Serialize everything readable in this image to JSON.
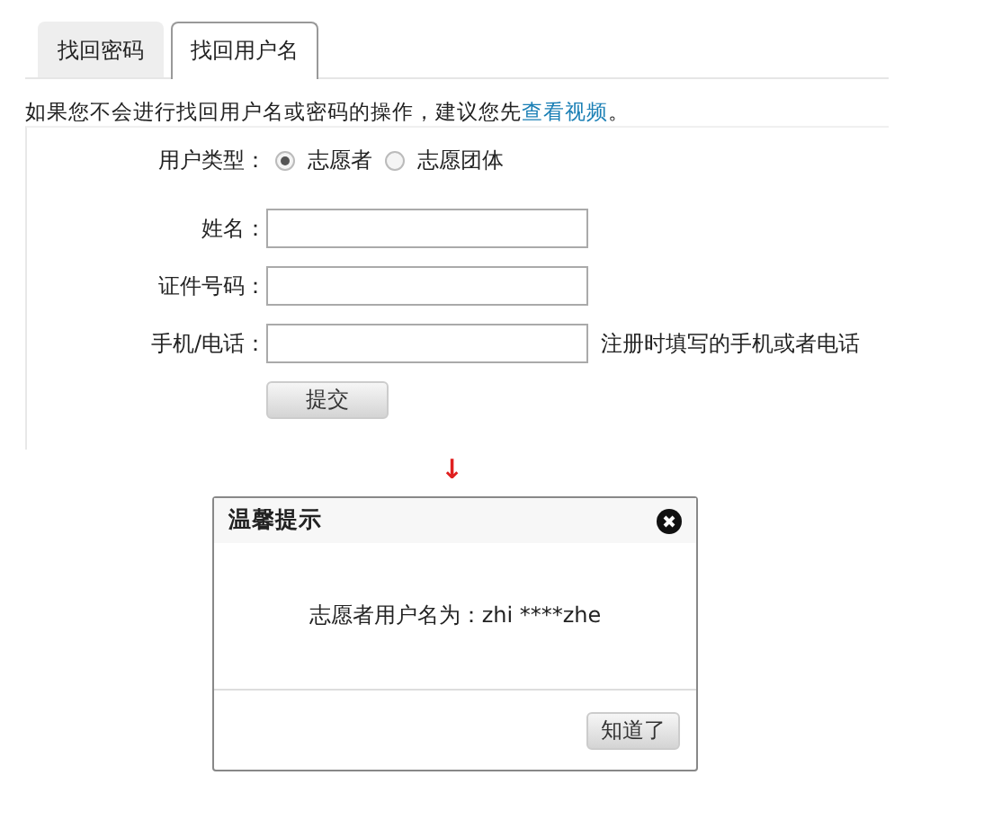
{
  "tabs": [
    {
      "label": "找回密码",
      "selected": false
    },
    {
      "label": "找回用户名",
      "selected": true
    }
  ],
  "notice": {
    "text": "如果您不会进行找回用户名或密码的操作，建议您先",
    "link": "查看视频",
    "end": "。"
  },
  "user_type": {
    "label": "用户类型：",
    "options": [
      {
        "label": "志愿者",
        "selected": true
      },
      {
        "label": "志愿团体",
        "selected": false
      }
    ]
  },
  "fields": [
    {
      "label": "姓名："
    },
    {
      "label": "证件号码："
    },
    {
      "label": "手机/电话：",
      "hint": "注册时填写的手机或者电话"
    }
  ],
  "submit": "提交",
  "arrow": "↓",
  "dialog": {
    "title": "温馨提示",
    "message": "志愿者用户名为：zhi ****zhe",
    "button": "知道了"
  }
}
